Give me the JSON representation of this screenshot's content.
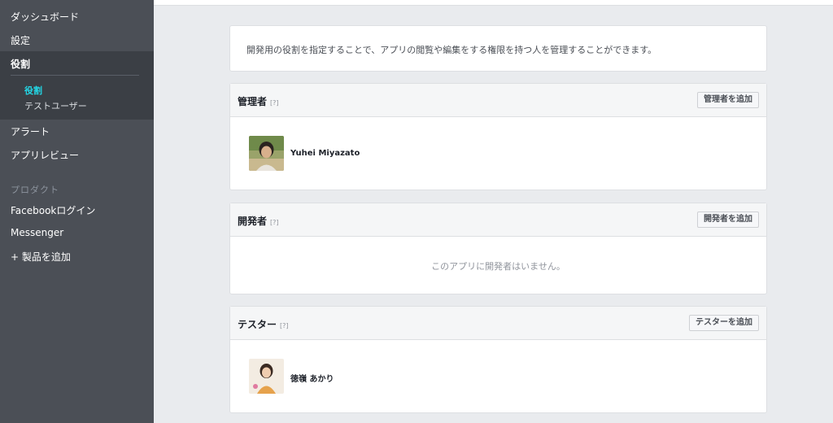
{
  "sidebar": {
    "items_top": [
      "ダッシュボード",
      "設定",
      "役割"
    ],
    "sub_items": [
      "役割",
      "テストユーザー"
    ],
    "items_mid": [
      "アラート",
      "アプリレビュー"
    ],
    "product_heading": "プロダクト",
    "products": [
      "Facebookログイン",
      "Messenger",
      "+ 製品を追加"
    ]
  },
  "intro": {
    "text": "開発用の役割を指定することで、アプリの閲覧や編集をする権限を持つ人を管理することができます。"
  },
  "admins": {
    "title": "管理者",
    "help": "[?]",
    "button": "管理者を追加",
    "members": [
      {
        "name": "Yuhei Miyazato"
      }
    ]
  },
  "developers": {
    "title": "開発者",
    "help": "[?]",
    "button": "開発者を追加",
    "empty_text": "このアプリに開発者はいません。"
  },
  "testers": {
    "title": "テスター",
    "help": "[?]",
    "button": "テスターを追加",
    "members": [
      {
        "name": "徳嶺 あかり"
      }
    ]
  },
  "colors": {
    "sidebar_bg": "#4b4f56",
    "active_sub": "#23d7e6",
    "page_bg": "#e9ebee"
  }
}
